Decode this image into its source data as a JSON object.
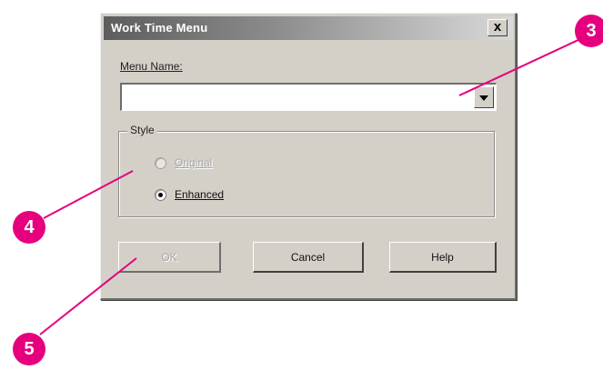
{
  "dialog": {
    "title": "Work Time Menu",
    "close_label": "x",
    "menu_name_label": "Menu Name:",
    "menu_name_value": "",
    "style": {
      "label": "Style",
      "options": [
        {
          "label": "Original",
          "checked": false,
          "enabled": false
        },
        {
          "label": "Enhanced",
          "checked": true,
          "enabled": true
        }
      ]
    },
    "buttons": {
      "ok": "OK",
      "cancel": "Cancel",
      "help": "Help"
    }
  },
  "callouts": [
    {
      "number": "3"
    },
    {
      "number": "4"
    },
    {
      "number": "5"
    }
  ],
  "colors": {
    "callout": "#e6007e",
    "dialog_face": "#d4d0c8"
  }
}
